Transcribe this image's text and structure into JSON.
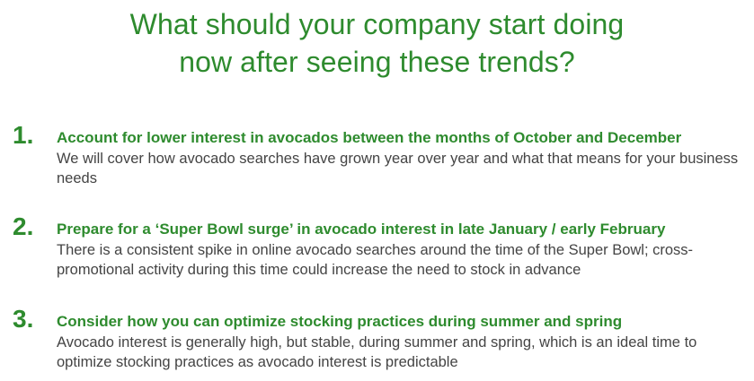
{
  "title": {
    "line1": "What should your company start doing",
    "line2": "now after seeing these trends?"
  },
  "items": [
    {
      "number": "1.",
      "heading": "Account for lower interest in avocados between the months of October and December",
      "body": "We will cover how avocado searches have grown year over year and what that means for your business needs"
    },
    {
      "number": "2.",
      "heading": "Prepare for a ‘Super Bowl surge’ in avocado interest in late January / early February",
      "body": "There is a consistent spike in online avocado searches around the time of the Super Bowl; cross-promotional activity during this time could increase the need to stock in advance"
    },
    {
      "number": "3.",
      "heading": "Consider how you can optimize stocking practices during summer and spring",
      "body": "Avocado interest is generally high, but stable, during summer and spring, which is an ideal time to optimize stocking practices as avocado interest is predictable"
    }
  ],
  "colors": {
    "accent": "#2e8b2e",
    "body_text": "#444444",
    "background": "#ffffff"
  }
}
